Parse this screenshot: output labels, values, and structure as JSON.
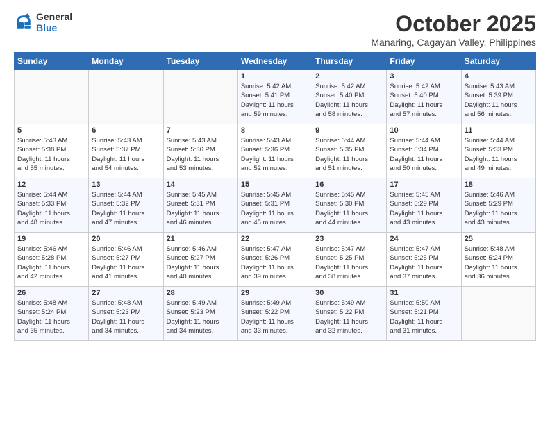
{
  "logo": {
    "line1": "General",
    "line2": "Blue"
  },
  "title": "October 2025",
  "subtitle": "Manaring, Cagayan Valley, Philippines",
  "days_of_week": [
    "Sunday",
    "Monday",
    "Tuesday",
    "Wednesday",
    "Thursday",
    "Friday",
    "Saturday"
  ],
  "weeks": [
    [
      {
        "day": "",
        "info": ""
      },
      {
        "day": "",
        "info": ""
      },
      {
        "day": "",
        "info": ""
      },
      {
        "day": "1",
        "info": "Sunrise: 5:42 AM\nSunset: 5:41 PM\nDaylight: 11 hours\nand 59 minutes."
      },
      {
        "day": "2",
        "info": "Sunrise: 5:42 AM\nSunset: 5:40 PM\nDaylight: 11 hours\nand 58 minutes."
      },
      {
        "day": "3",
        "info": "Sunrise: 5:42 AM\nSunset: 5:40 PM\nDaylight: 11 hours\nand 57 minutes."
      },
      {
        "day": "4",
        "info": "Sunrise: 5:43 AM\nSunset: 5:39 PM\nDaylight: 11 hours\nand 56 minutes."
      }
    ],
    [
      {
        "day": "5",
        "info": "Sunrise: 5:43 AM\nSunset: 5:38 PM\nDaylight: 11 hours\nand 55 minutes."
      },
      {
        "day": "6",
        "info": "Sunrise: 5:43 AM\nSunset: 5:37 PM\nDaylight: 11 hours\nand 54 minutes."
      },
      {
        "day": "7",
        "info": "Sunrise: 5:43 AM\nSunset: 5:36 PM\nDaylight: 11 hours\nand 53 minutes."
      },
      {
        "day": "8",
        "info": "Sunrise: 5:43 AM\nSunset: 5:36 PM\nDaylight: 11 hours\nand 52 minutes."
      },
      {
        "day": "9",
        "info": "Sunrise: 5:44 AM\nSunset: 5:35 PM\nDaylight: 11 hours\nand 51 minutes."
      },
      {
        "day": "10",
        "info": "Sunrise: 5:44 AM\nSunset: 5:34 PM\nDaylight: 11 hours\nand 50 minutes."
      },
      {
        "day": "11",
        "info": "Sunrise: 5:44 AM\nSunset: 5:33 PM\nDaylight: 11 hours\nand 49 minutes."
      }
    ],
    [
      {
        "day": "12",
        "info": "Sunrise: 5:44 AM\nSunset: 5:33 PM\nDaylight: 11 hours\nand 48 minutes."
      },
      {
        "day": "13",
        "info": "Sunrise: 5:44 AM\nSunset: 5:32 PM\nDaylight: 11 hours\nand 47 minutes."
      },
      {
        "day": "14",
        "info": "Sunrise: 5:45 AM\nSunset: 5:31 PM\nDaylight: 11 hours\nand 46 minutes."
      },
      {
        "day": "15",
        "info": "Sunrise: 5:45 AM\nSunset: 5:31 PM\nDaylight: 11 hours\nand 45 minutes."
      },
      {
        "day": "16",
        "info": "Sunrise: 5:45 AM\nSunset: 5:30 PM\nDaylight: 11 hours\nand 44 minutes."
      },
      {
        "day": "17",
        "info": "Sunrise: 5:45 AM\nSunset: 5:29 PM\nDaylight: 11 hours\nand 43 minutes."
      },
      {
        "day": "18",
        "info": "Sunrise: 5:46 AM\nSunset: 5:29 PM\nDaylight: 11 hours\nand 43 minutes."
      }
    ],
    [
      {
        "day": "19",
        "info": "Sunrise: 5:46 AM\nSunset: 5:28 PM\nDaylight: 11 hours\nand 42 minutes."
      },
      {
        "day": "20",
        "info": "Sunrise: 5:46 AM\nSunset: 5:27 PM\nDaylight: 11 hours\nand 41 minutes."
      },
      {
        "day": "21",
        "info": "Sunrise: 5:46 AM\nSunset: 5:27 PM\nDaylight: 11 hours\nand 40 minutes."
      },
      {
        "day": "22",
        "info": "Sunrise: 5:47 AM\nSunset: 5:26 PM\nDaylight: 11 hours\nand 39 minutes."
      },
      {
        "day": "23",
        "info": "Sunrise: 5:47 AM\nSunset: 5:25 PM\nDaylight: 11 hours\nand 38 minutes."
      },
      {
        "day": "24",
        "info": "Sunrise: 5:47 AM\nSunset: 5:25 PM\nDaylight: 11 hours\nand 37 minutes."
      },
      {
        "day": "25",
        "info": "Sunrise: 5:48 AM\nSunset: 5:24 PM\nDaylight: 11 hours\nand 36 minutes."
      }
    ],
    [
      {
        "day": "26",
        "info": "Sunrise: 5:48 AM\nSunset: 5:24 PM\nDaylight: 11 hours\nand 35 minutes."
      },
      {
        "day": "27",
        "info": "Sunrise: 5:48 AM\nSunset: 5:23 PM\nDaylight: 11 hours\nand 34 minutes."
      },
      {
        "day": "28",
        "info": "Sunrise: 5:49 AM\nSunset: 5:23 PM\nDaylight: 11 hours\nand 34 minutes."
      },
      {
        "day": "29",
        "info": "Sunrise: 5:49 AM\nSunset: 5:22 PM\nDaylight: 11 hours\nand 33 minutes."
      },
      {
        "day": "30",
        "info": "Sunrise: 5:49 AM\nSunset: 5:22 PM\nDaylight: 11 hours\nand 32 minutes."
      },
      {
        "day": "31",
        "info": "Sunrise: 5:50 AM\nSunset: 5:21 PM\nDaylight: 11 hours\nand 31 minutes."
      },
      {
        "day": "",
        "info": ""
      }
    ]
  ]
}
